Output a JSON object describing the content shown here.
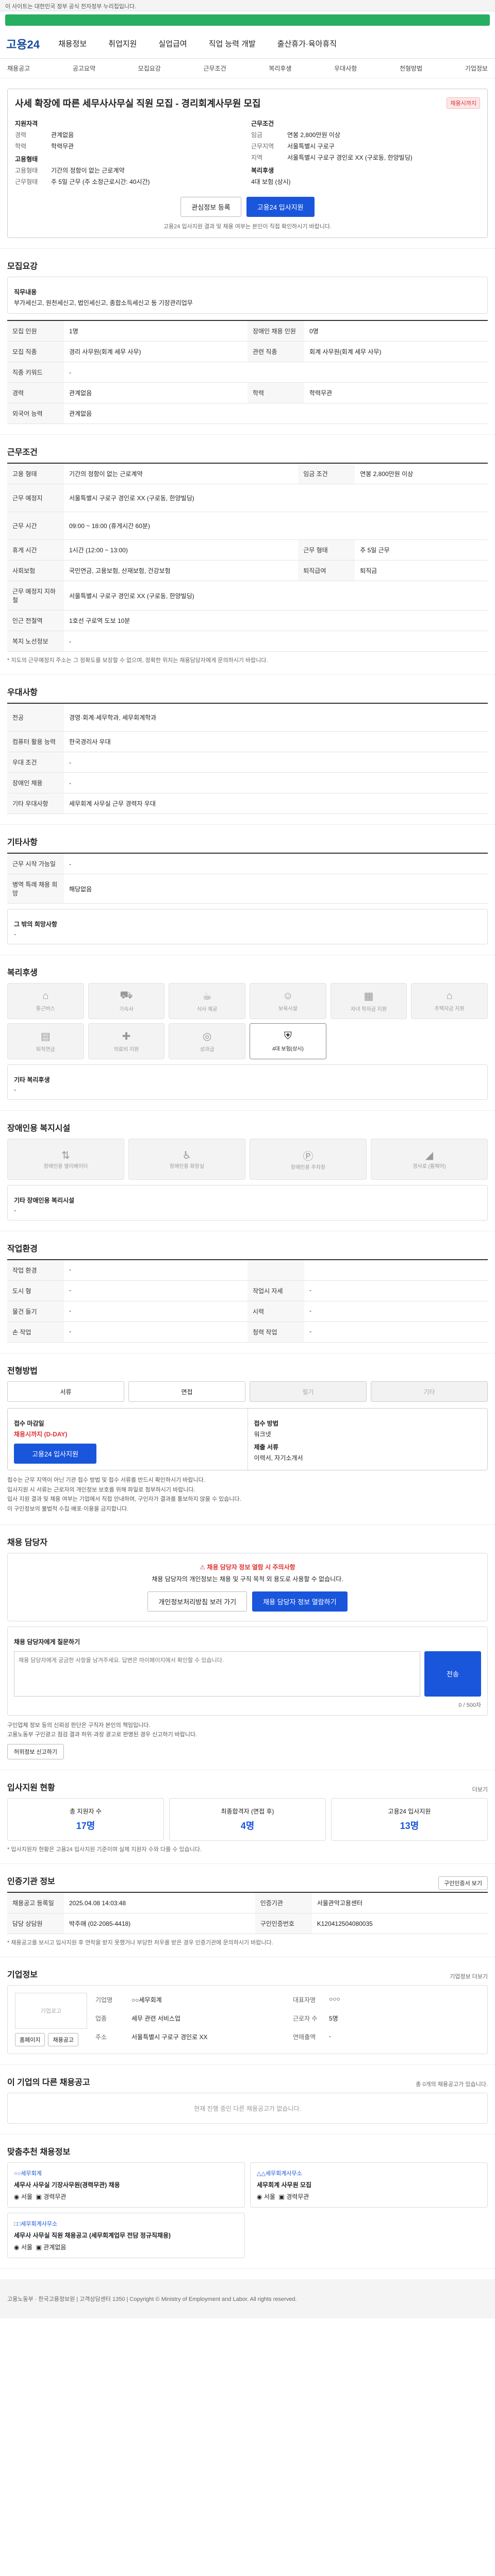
{
  "topbar": "이 사이트는 대한민국 정부 공식 전자정부 누리집입니다.",
  "header": {
    "logo": "고용24",
    "gnb": [
      "채용정보",
      "취업지원",
      "실업급여",
      "직업 능력 개발",
      "출산휴가·육아휴직"
    ],
    "right": [
      "로그인",
      "회원가입"
    ]
  },
  "subnav": [
    "채용공고",
    "공고요약",
    "모집요강",
    "근무조건",
    "복리후생",
    "우대사항",
    "전형방법",
    "기업정보"
  ],
  "summary": {
    "title": "사세 확장에 따른 세무사사무실 직원 모집 - 경리회계사무원 모집",
    "badge": "채용시까지",
    "company_head": "지원자격",
    "left": [
      {
        "k": "경력",
        "v": "관계없음"
      },
      {
        "k": "학력",
        "v": "학력무관"
      }
    ],
    "left_head2": "고용형태",
    "left2": [
      {
        "k": "고용형태",
        "v": "기간의 정함이 없는 근로계약"
      },
      {
        "k": "근무형태",
        "v": "주 5일 근무 (주 소정근로시간: 40시간)"
      }
    ],
    "right_head": "근무조건",
    "right": [
      {
        "k": "임금",
        "v": "연봉 2,800만원 이상"
      },
      {
        "k": "근무지역",
        "v": "서울특별시 구로구"
      },
      {
        "k": "지역",
        "v": "서울특별시 구로구 경인로 XX (구로동, 한양빌딩)"
      }
    ],
    "right_head2": "복리후생",
    "right2": "4대 보험 (상시)",
    "btn_scrap": "관심정보 등록",
    "btn_apply": "고용24 입사지원",
    "note": "고용24 입사지원 결과 및 채용 여부는 본인이 직접 확인하시기 바랍니다."
  },
  "recruit": {
    "title": "모집요강",
    "job_head": "직무내용",
    "job_desc": "부가세신고, 원천세신고, 법인세신고, 종합소득세신고 등 기장관리업무",
    "rows": [
      {
        "k": "모집 인원",
        "v": "1명",
        "k2": "장애인 채용 인원",
        "v2": "0명"
      },
      {
        "k": "모집 직종",
        "v": "경리 사무원(회계 세무 사무)",
        "k2": "관련 직종",
        "v2": "회계 사무원(회계 세무 사무)"
      },
      {
        "k": "직종 키워드",
        "v": "-",
        "k2": "",
        "v2": ""
      },
      {
        "k": "경력",
        "v": "관계없음",
        "k2": "학력",
        "v2": "학력무관"
      },
      {
        "k": "외국어 능력",
        "v": "관계없음",
        "k2": "",
        "v2": ""
      }
    ]
  },
  "work": {
    "title": "근무조건",
    "rows": [
      {
        "k": "고용 형태",
        "v": "기간의 정함이 없는 근로계약",
        "k2": "임금 조건",
        "v2": "연봉 2,800만원 이상"
      },
      {
        "k": "근무 예정지",
        "v": "서울특별시 구로구 경인로 XX (구로동, 한양빌딩)",
        "k2": "",
        "v2": ""
      },
      {
        "k": "근무 시간",
        "v": "09:00 ~ 18:00 (휴게시간 60분)",
        "k2": "",
        "v2": ""
      },
      {
        "k": "휴게 시간",
        "v": "1시간 (12:00 ~ 13:00)",
        "k2": "근무 형태",
        "v2": "주 5일 근무"
      },
      {
        "k": "사회보험",
        "v": "국민연금, 고용보험, 산재보험, 건강보험",
        "k2": "퇴직급여",
        "v2": "퇴직금"
      },
      {
        "k": "근무 예정지 지하철",
        "v": "서울특별시 구로구 경인로 XX (구로동, 한양빌딩)",
        "k2": "",
        "v2": ""
      },
      {
        "k": "인근 전철역",
        "v": "1호선 구로역 도보 10분",
        "k2": "",
        "v2": ""
      },
      {
        "k": "복지 노선정보",
        "v": "-",
        "k2": "",
        "v2": ""
      }
    ],
    "note": "* 지도의 근무예정지 주소는 그 정확도를 보장할 수 없으며, 정확한 위치는 채용담당자에게 문의하시기 바랍니다."
  },
  "pref": {
    "title": "우대사항",
    "rows": [
      {
        "k": "전공",
        "v": "경영·회계·세무학과, 세무회계학과"
      },
      {
        "k": "컴퓨터 활용 능력",
        "v": "한국경리사 우대"
      },
      {
        "k": "우대 조건",
        "v": "-"
      },
      {
        "k": "장애인 채용",
        "v": "-"
      },
      {
        "k": "기타 우대사항",
        "v": "세무회계 사무실 근무 경력자 우대"
      }
    ]
  },
  "etc": {
    "title": "기타사항",
    "rows": [
      {
        "k": "근무 시작 가능일",
        "v": "-"
      },
      {
        "k": "병역 특례 채용 희망",
        "v": "해당없음"
      }
    ],
    "box_head": "그 밖의 희망사항",
    "box_val": "-"
  },
  "welfare": {
    "title": "복리후생",
    "items": [
      {
        "icon": "house-icon",
        "glyph": "⌂",
        "label": "통근버스",
        "on": false
      },
      {
        "icon": "car-icon",
        "glyph": "⛟",
        "label": "기숙사",
        "on": false
      },
      {
        "icon": "meal-icon",
        "glyph": "☕",
        "label": "식사 제공",
        "on": false
      },
      {
        "icon": "child-icon",
        "glyph": "☺",
        "label": "보육시설",
        "on": false
      },
      {
        "icon": "calendar-icon",
        "glyph": "▦",
        "label": "자녀 학자금 지원",
        "on": false
      },
      {
        "icon": "house-icon",
        "glyph": "⌂",
        "label": "주택자금 지원",
        "on": false
      },
      {
        "icon": "doc-icon",
        "glyph": "▤",
        "label": "퇴직연금",
        "on": false
      },
      {
        "icon": "medical-icon",
        "glyph": "✚",
        "label": "의료비 지원",
        "on": false
      },
      {
        "icon": "bonus-icon",
        "glyph": "◎",
        "label": "성과급",
        "on": false
      },
      {
        "icon": "insurance-icon",
        "glyph": "⛨",
        "label": "4대 보험(상시)",
        "on": true
      }
    ],
    "box_head": "기타 복리후생",
    "box_val": "-"
  },
  "disability": {
    "title": "장애인용 복지시설",
    "items": [
      {
        "icon": "elevator-icon",
        "label": "장애인용 엘리베이터"
      },
      {
        "icon": "toilet-icon",
        "label": "장애인용 화장실"
      },
      {
        "icon": "parking-icon",
        "label": "장애인용 주차장"
      },
      {
        "icon": "ramp-icon",
        "label": "경사로 (휠체어)"
      }
    ],
    "box_head": "기타 장애인용 복리시설",
    "box_val": "-"
  },
  "environment": {
    "title": "작업환경",
    "rows": [
      {
        "k": "작업 환경",
        "v": "-",
        "k2": "",
        "v2": ""
      },
      {
        "k": "도시 형",
        "v": "-",
        "k2": "작업시 자세",
        "v2": "-"
      },
      {
        "k": "물건 들기",
        "v": "-",
        "k2": "시력",
        "v2": "-"
      },
      {
        "k": "손 작업",
        "v": "-",
        "k2": "청력 작업",
        "v2": "-"
      }
    ]
  },
  "method": {
    "title": "전형방법",
    "methods": [
      {
        "label": "서류",
        "on": true
      },
      {
        "label": "면접",
        "on": true
      },
      {
        "label": "필기",
        "on": false
      },
      {
        "label": "기타",
        "on": false
      }
    ],
    "deadline_head": "접수 마감일",
    "deadline": "채용시까지 (D-DAY)",
    "apply_head": "접수 방법",
    "apply_via": "워크넷",
    "docs_head": "제출 서류",
    "docs": "이력서, 자기소개서",
    "apply_btn": "고용24 입사지원",
    "bullets": [
      "접수는 근무 지역이 아닌 기관 접수 방법 및 접수 서류를 반드시 확인하시기 바랍니다.",
      "입사지원 시 서류는 근로자의 개인정보 보호를 위해 파일로 첨부하시기 바랍니다.",
      "입사 지원 결과 및 채용 여부는 기업에서 직접 안내하며, 구인자가 결과를 통보하지 않을 수 있습니다.",
      "이 구인정보의 불법적 수집·배포·이용을 금지합니다."
    ]
  },
  "contact": {
    "title": "채용 담당자",
    "notice_title": "채용 담당자 정보 열람 시 주의사항",
    "notice_body": "채용 담당자의 개인정보는 채용 및 구직 목적 외 용도로 사용할 수 없습니다.",
    "btn1": "개인정보처리방침 보러 가기",
    "btn2": "채용 담당자 정보 열람하기",
    "inquiry_head": "채용 담당자에게 질문하기",
    "inquiry_placeholder": "채용 담당자에게 궁금한 사항을 남겨주세요. 답변은 마이페이지에서 확인할 수 있습니다.",
    "inquiry_count": "0 / 500자",
    "send": "전송",
    "bullets": [
      "구인업체 정보 등의 신뢰성 판단은 구직자 본인의 책임입니다.",
      "고용노동부 구인광고 점검 결과 허위·과장 광고로 판명된 경우 신고하기 바랍니다."
    ],
    "report_btn": "허위정보 신고하기"
  },
  "stats": {
    "title": "입사지원 현황",
    "more": "더보기",
    "items": [
      {
        "label": "총 지원자 수",
        "value": "17명"
      },
      {
        "label": "최종합격자 (면접 후)",
        "value": "4명"
      },
      {
        "label": "고용24 입사지원",
        "value": "13명"
      }
    ],
    "note": "* 입사지원자 현황은 고용24 입사지원 기준이며 실제 지원자 수와 다를 수 있습니다."
  },
  "agency": {
    "title": "인증기관 정보",
    "btn": "구인인증서 보기",
    "rows": [
      {
        "k": "채용공고 등록일",
        "v": "2025.04.08 14:03:48",
        "k2": "인증기관",
        "v2": "서울관악고용센터"
      },
      {
        "k": "담당 상담원",
        "v": "박주애 (02-2085-4418)",
        "k2": "구인인증번호",
        "v2": "K120412504080035"
      }
    ],
    "note": "* 채용공고를 보시고 입사지원 후 연락을 받지 못했거나 부당한 처우를 받은 경우 인증기관에 문의하시기 바랍니다."
  },
  "company": {
    "title": "기업정보",
    "more": "기업정보 더보기",
    "logo_alt": "기업로고",
    "fields": [
      {
        "k": "기업명",
        "v": "○○세무회계"
      },
      {
        "k": "대표자명",
        "v": "○○○"
      },
      {
        "k": "업종",
        "v": "세무 관련 서비스업"
      },
      {
        "k": "근로자 수",
        "v": "5명"
      },
      {
        "k": "주소",
        "v": "서울특별시 구로구 경인로 XX"
      },
      {
        "k": "연매출액",
        "v": "-"
      }
    ],
    "btn1": "홈페이지",
    "btn2": "채용공고"
  },
  "similar": {
    "title": "이 기업의 다른 채용공고",
    "count_text": "총 0개의 채용공고가 있습니다.",
    "empty": "현재 진행 중인 다른 채용공고가 없습니다."
  },
  "recommend": {
    "title": "맞춤추천 채용정보",
    "items": [
      {
        "company": "○○세무회계",
        "title": "세무사 사무실 기장사무원(경력무관) 채용",
        "tag1": "서울",
        "tag2": "경력무관"
      },
      {
        "company": "△△세무회계사무소",
        "title": "세무회계 사무원 모집",
        "tag1": "서울",
        "tag2": "경력무관"
      },
      {
        "company": "□□세무회계사무소",
        "title": "세무사 사무실 직원 채용공고 (세무회계업무 전담 정규직채용)",
        "tag1": "서울",
        "tag2": "관계없음"
      }
    ]
  },
  "footer": {
    "text": "고용노동부 · 한국고용정보원 | 고객상담센터 1350 | Copyright © Ministry of Employment and Labor. All rights reserved."
  }
}
